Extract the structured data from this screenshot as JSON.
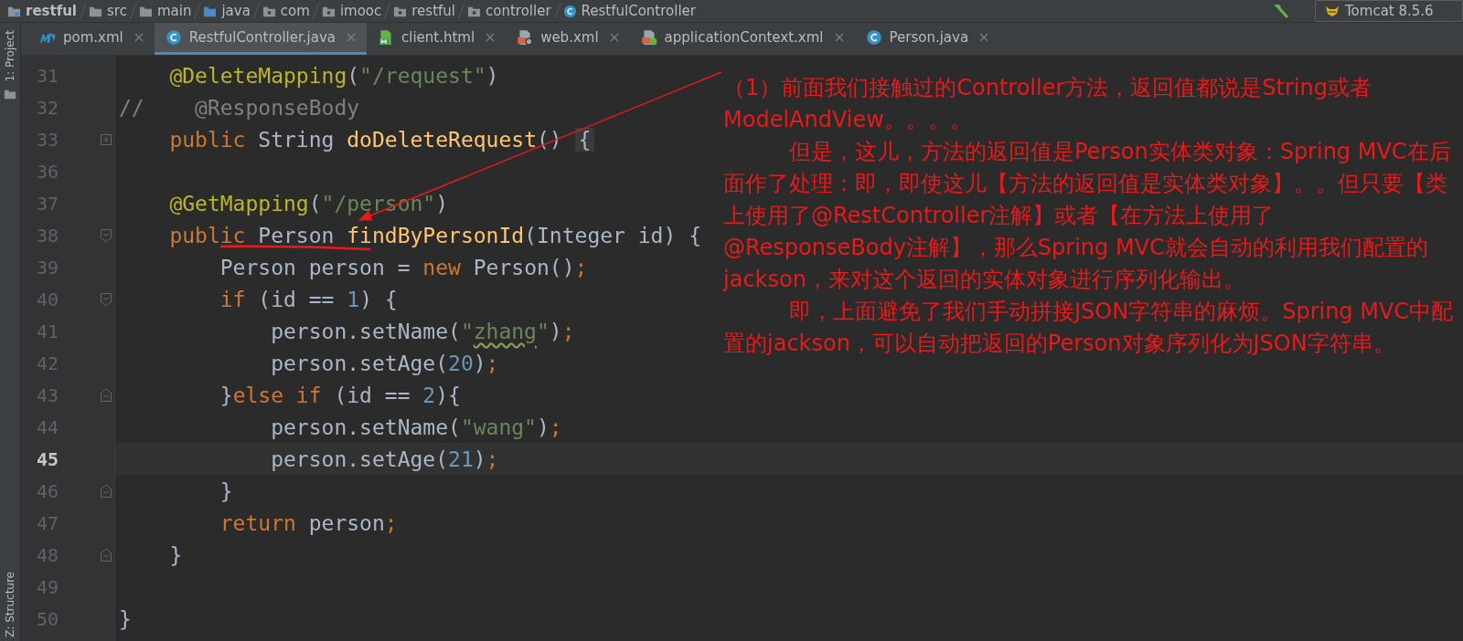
{
  "breadcrumbs": [
    {
      "label": "restful",
      "kind": "module",
      "bold": true
    },
    {
      "label": "src",
      "kind": "folder",
      "bold": false
    },
    {
      "label": "main",
      "kind": "folder",
      "bold": false
    },
    {
      "label": "java",
      "kind": "source",
      "bold": false
    },
    {
      "label": "com",
      "kind": "package",
      "bold": false
    },
    {
      "label": "imooc",
      "kind": "package",
      "bold": false
    },
    {
      "label": "restful",
      "kind": "package",
      "bold": false
    },
    {
      "label": "controller",
      "kind": "package",
      "bold": false
    },
    {
      "label": "RestfulController",
      "kind": "class",
      "bold": false
    }
  ],
  "run_config": {
    "label": "Tomcat 8.5.6"
  },
  "side_tools": {
    "top": "1: Project",
    "bottom": "Z: Structure"
  },
  "tabs": [
    {
      "label": "pom.xml",
      "kind": "maven",
      "selected": false
    },
    {
      "label": "RestfulController.java",
      "kind": "class",
      "selected": true
    },
    {
      "label": "client.html",
      "kind": "html",
      "selected": false
    },
    {
      "label": "web.xml",
      "kind": "xml",
      "selected": false
    },
    {
      "label": "applicationContext.xml",
      "kind": "spring",
      "selected": false
    },
    {
      "label": "Person.java",
      "kind": "class",
      "selected": false
    }
  ],
  "code_lines": [
    {
      "number": "31",
      "current": false,
      "tokens": [
        {
          "kind": "ann",
          "t": "    @DeleteMapping"
        },
        {
          "kind": "plain",
          "t": "("
        },
        {
          "kind": "str",
          "t": "\"/request\""
        },
        {
          "kind": "plain",
          "t": ")"
        }
      ]
    },
    {
      "number": "32",
      "current": false,
      "tokens": [
        {
          "kind": "comment",
          "t": "//    @ResponseBody"
        }
      ]
    },
    {
      "number": "33",
      "current": false,
      "fold": {
        "kind": "collapsed"
      },
      "tokens": [
        {
          "kind": "kw",
          "t": "    public"
        },
        {
          "kind": "plain",
          "t": " String "
        },
        {
          "kind": "method",
          "t": "doDeleteRequest"
        },
        {
          "kind": "plain",
          "t": "() "
        },
        {
          "kind": "fold",
          "t": "{"
        }
      ]
    },
    {
      "number": "36",
      "current": false
    },
    {
      "number": "37",
      "current": false,
      "tokens": [
        {
          "kind": "ann",
          "t": "    @GetMapping"
        },
        {
          "kind": "plain",
          "t": "("
        },
        {
          "kind": "str",
          "t": "\"/person\""
        },
        {
          "kind": "plain",
          "t": ")"
        }
      ]
    },
    {
      "number": "38",
      "current": false,
      "fold": {
        "kind": "start"
      },
      "tokens": [
        {
          "kind": "kw",
          "t": "    public"
        },
        {
          "kind": "plain",
          "t": " Person "
        },
        {
          "kind": "method",
          "t": "findByPersonId"
        },
        {
          "kind": "plain",
          "t": "(Integer id) {"
        }
      ]
    },
    {
      "number": "39",
      "current": false,
      "tokens": [
        {
          "kind": "plain",
          "t": "        Person person = "
        },
        {
          "kind": "kw",
          "t": "new"
        },
        {
          "kind": "plain",
          "t": " Person()"
        },
        {
          "kind": "kw",
          "t": ";"
        }
      ]
    },
    {
      "number": "40",
      "current": false,
      "fold": {
        "kind": "start"
      },
      "tokens": [
        {
          "kind": "kw",
          "t": "        if"
        },
        {
          "kind": "plain",
          "t": " (id == "
        },
        {
          "kind": "num",
          "t": "1"
        },
        {
          "kind": "plain",
          "t": ") {"
        }
      ]
    },
    {
      "number": "41",
      "current": false,
      "tokens": [
        {
          "kind": "plain",
          "t": "            person.setName("
        },
        {
          "kind": "str",
          "t": "\""
        },
        {
          "kind": "typo",
          "t": "zhang"
        },
        {
          "kind": "str",
          "t": "\""
        },
        {
          "kind": "plain",
          "t": ")"
        },
        {
          "kind": "kw",
          "t": ";"
        }
      ]
    },
    {
      "number": "42",
      "current": false,
      "tokens": [
        {
          "kind": "plain",
          "t": "            person.setAge("
        },
        {
          "kind": "num",
          "t": "20"
        },
        {
          "kind": "plain",
          "t": ")"
        },
        {
          "kind": "kw",
          "t": ";"
        }
      ]
    },
    {
      "number": "43",
      "current": false,
      "fold": {
        "kind": "end"
      },
      "tokens": [
        {
          "kind": "plain",
          "t": "        }"
        },
        {
          "kind": "kw",
          "t": "else if"
        },
        {
          "kind": "plain",
          "t": " (id == "
        },
        {
          "kind": "num",
          "t": "2"
        },
        {
          "kind": "plain",
          "t": "){"
        }
      ]
    },
    {
      "number": "44",
      "current": false,
      "tokens": [
        {
          "kind": "plain",
          "t": "            person.setName("
        },
        {
          "kind": "str",
          "t": "\"wang\""
        },
        {
          "kind": "plain",
          "t": ")"
        },
        {
          "kind": "kw",
          "t": ";"
        }
      ]
    },
    {
      "number": "45",
      "current": true,
      "tokens": [
        {
          "kind": "plain",
          "t": "            person.setAge("
        },
        {
          "kind": "num",
          "t": "21"
        },
        {
          "kind": "plain",
          "t": ")"
        },
        {
          "kind": "kw",
          "t": ";"
        }
      ]
    },
    {
      "number": "46",
      "current": false,
      "fold": {
        "kind": "end"
      },
      "tokens": [
        {
          "kind": "plain",
          "t": "        }"
        }
      ]
    },
    {
      "number": "47",
      "current": false,
      "tokens": [
        {
          "kind": "kw",
          "t": "        return"
        },
        {
          "kind": "plain",
          "t": " person"
        },
        {
          "kind": "kw",
          "t": ";"
        }
      ]
    },
    {
      "number": "48",
      "current": false,
      "fold": {
        "kind": "end"
      },
      "tokens": [
        {
          "kind": "plain",
          "t": "    }"
        }
      ]
    },
    {
      "number": "49",
      "current": false
    },
    {
      "number": "50",
      "current": false,
      "tokens": [
        {
          "kind": "plain",
          "t": "}"
        }
      ]
    }
  ],
  "annotation": {
    "paragraphs": [
      {
        "kind": "first",
        "text": "（1）前面我们接触过的Controller方法，返回值都说是String或者ModelAndView。。。。"
      },
      {
        "kind": "indented",
        "text": "但是，这儿，方法的返回值是Person实体类对象：Spring MVC在后面作了处理：即，即使这儿【方法的返回值是实体类对象】。。但只要【类上使用了@RestController注解】或者【在方法上使用了@ResponseBody注解】，那么Spring MVC就会自动的利用我们配置的jackson，来对这个返回的实体对象进行序列化输出。"
      },
      {
        "kind": "indented",
        "text": "即，上面避免了我们手动拼接JSON字符串的麻烦。Spring MVC中配置的jackson，可以自动把返回的Person对象序列化为JSON字符串。"
      }
    ]
  }
}
